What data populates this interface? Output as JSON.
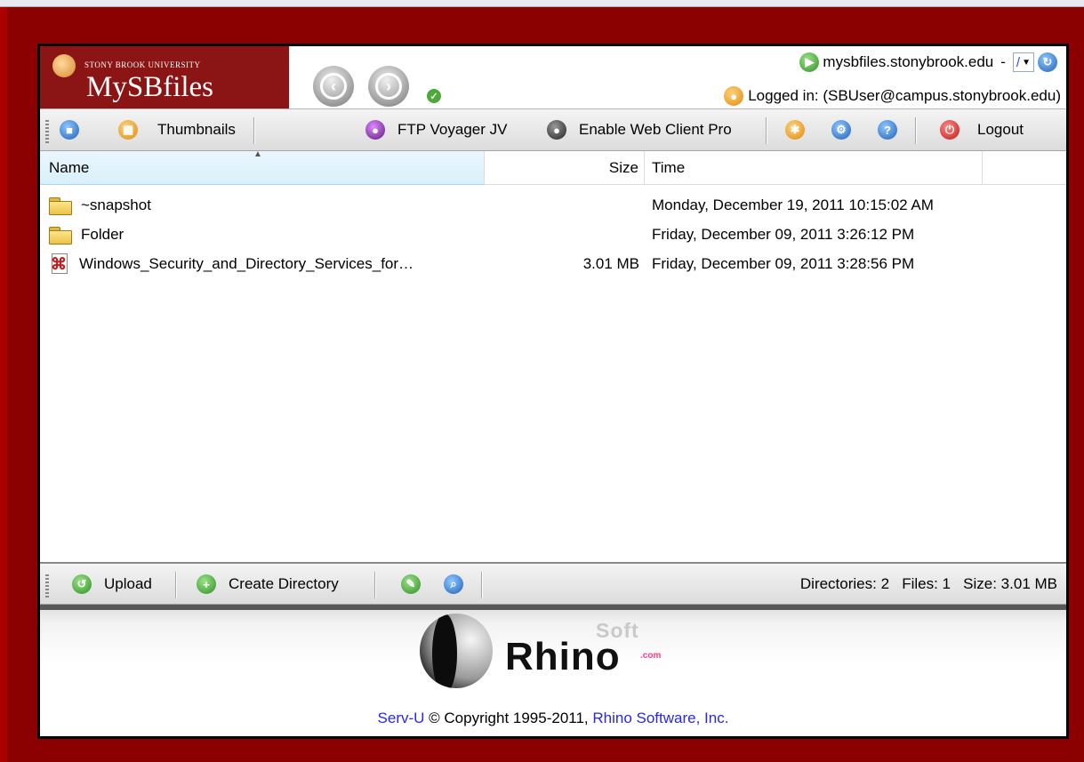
{
  "header": {
    "university": "STONY BROOK UNIVERSITY",
    "app_title": "MySBfiles",
    "server": "mysbfiles.stonybrook.edu",
    "server_sep": "-",
    "path": "/",
    "logged_in_text": "Logged in: (SBUser@campus.stonybrook.edu)"
  },
  "toolbar": {
    "thumbnails_label": "Thumbnails",
    "ftp_voyager_label": "FTP Voyager JV",
    "enable_web_client_label": "Enable Web Client Pro",
    "logout_label": "Logout"
  },
  "columns": {
    "name": "Name",
    "size": "Size",
    "time": "Time"
  },
  "files": [
    {
      "type": "folder",
      "icon": "folder-icon",
      "name": "~snapshot",
      "size": "",
      "time": "Monday, December 19, 2011 10:15:02 AM"
    },
    {
      "type": "folder",
      "icon": "folder-icon",
      "name": "Folder",
      "size": "",
      "time": "Friday, December 09, 2011 3:26:12 PM"
    },
    {
      "type": "file",
      "icon": "pdf-icon",
      "name": "Windows_Security_and_Directory_Services_for…",
      "size": "3.01 MB",
      "time": "Friday, December 09, 2011 3:28:56 PM"
    }
  ],
  "bottombar": {
    "upload_label": "Upload",
    "create_directory_label": "Create Directory",
    "status": "Directories: 2   Files: 1   Size: 3.01 MB"
  },
  "footer": {
    "logo_word": "Rhino",
    "logo_soft": "Soft",
    "logo_com": ".com",
    "servu_link": "Serv-U",
    "copyright_text": " © Copyright 1995-2011, ",
    "company_link": "Rhino Software, Inc."
  },
  "colors": {
    "background": "#8b0000",
    "brand": "#8b1414",
    "link": "#2a28e0",
    "selected_column": "#d9f0fc"
  }
}
